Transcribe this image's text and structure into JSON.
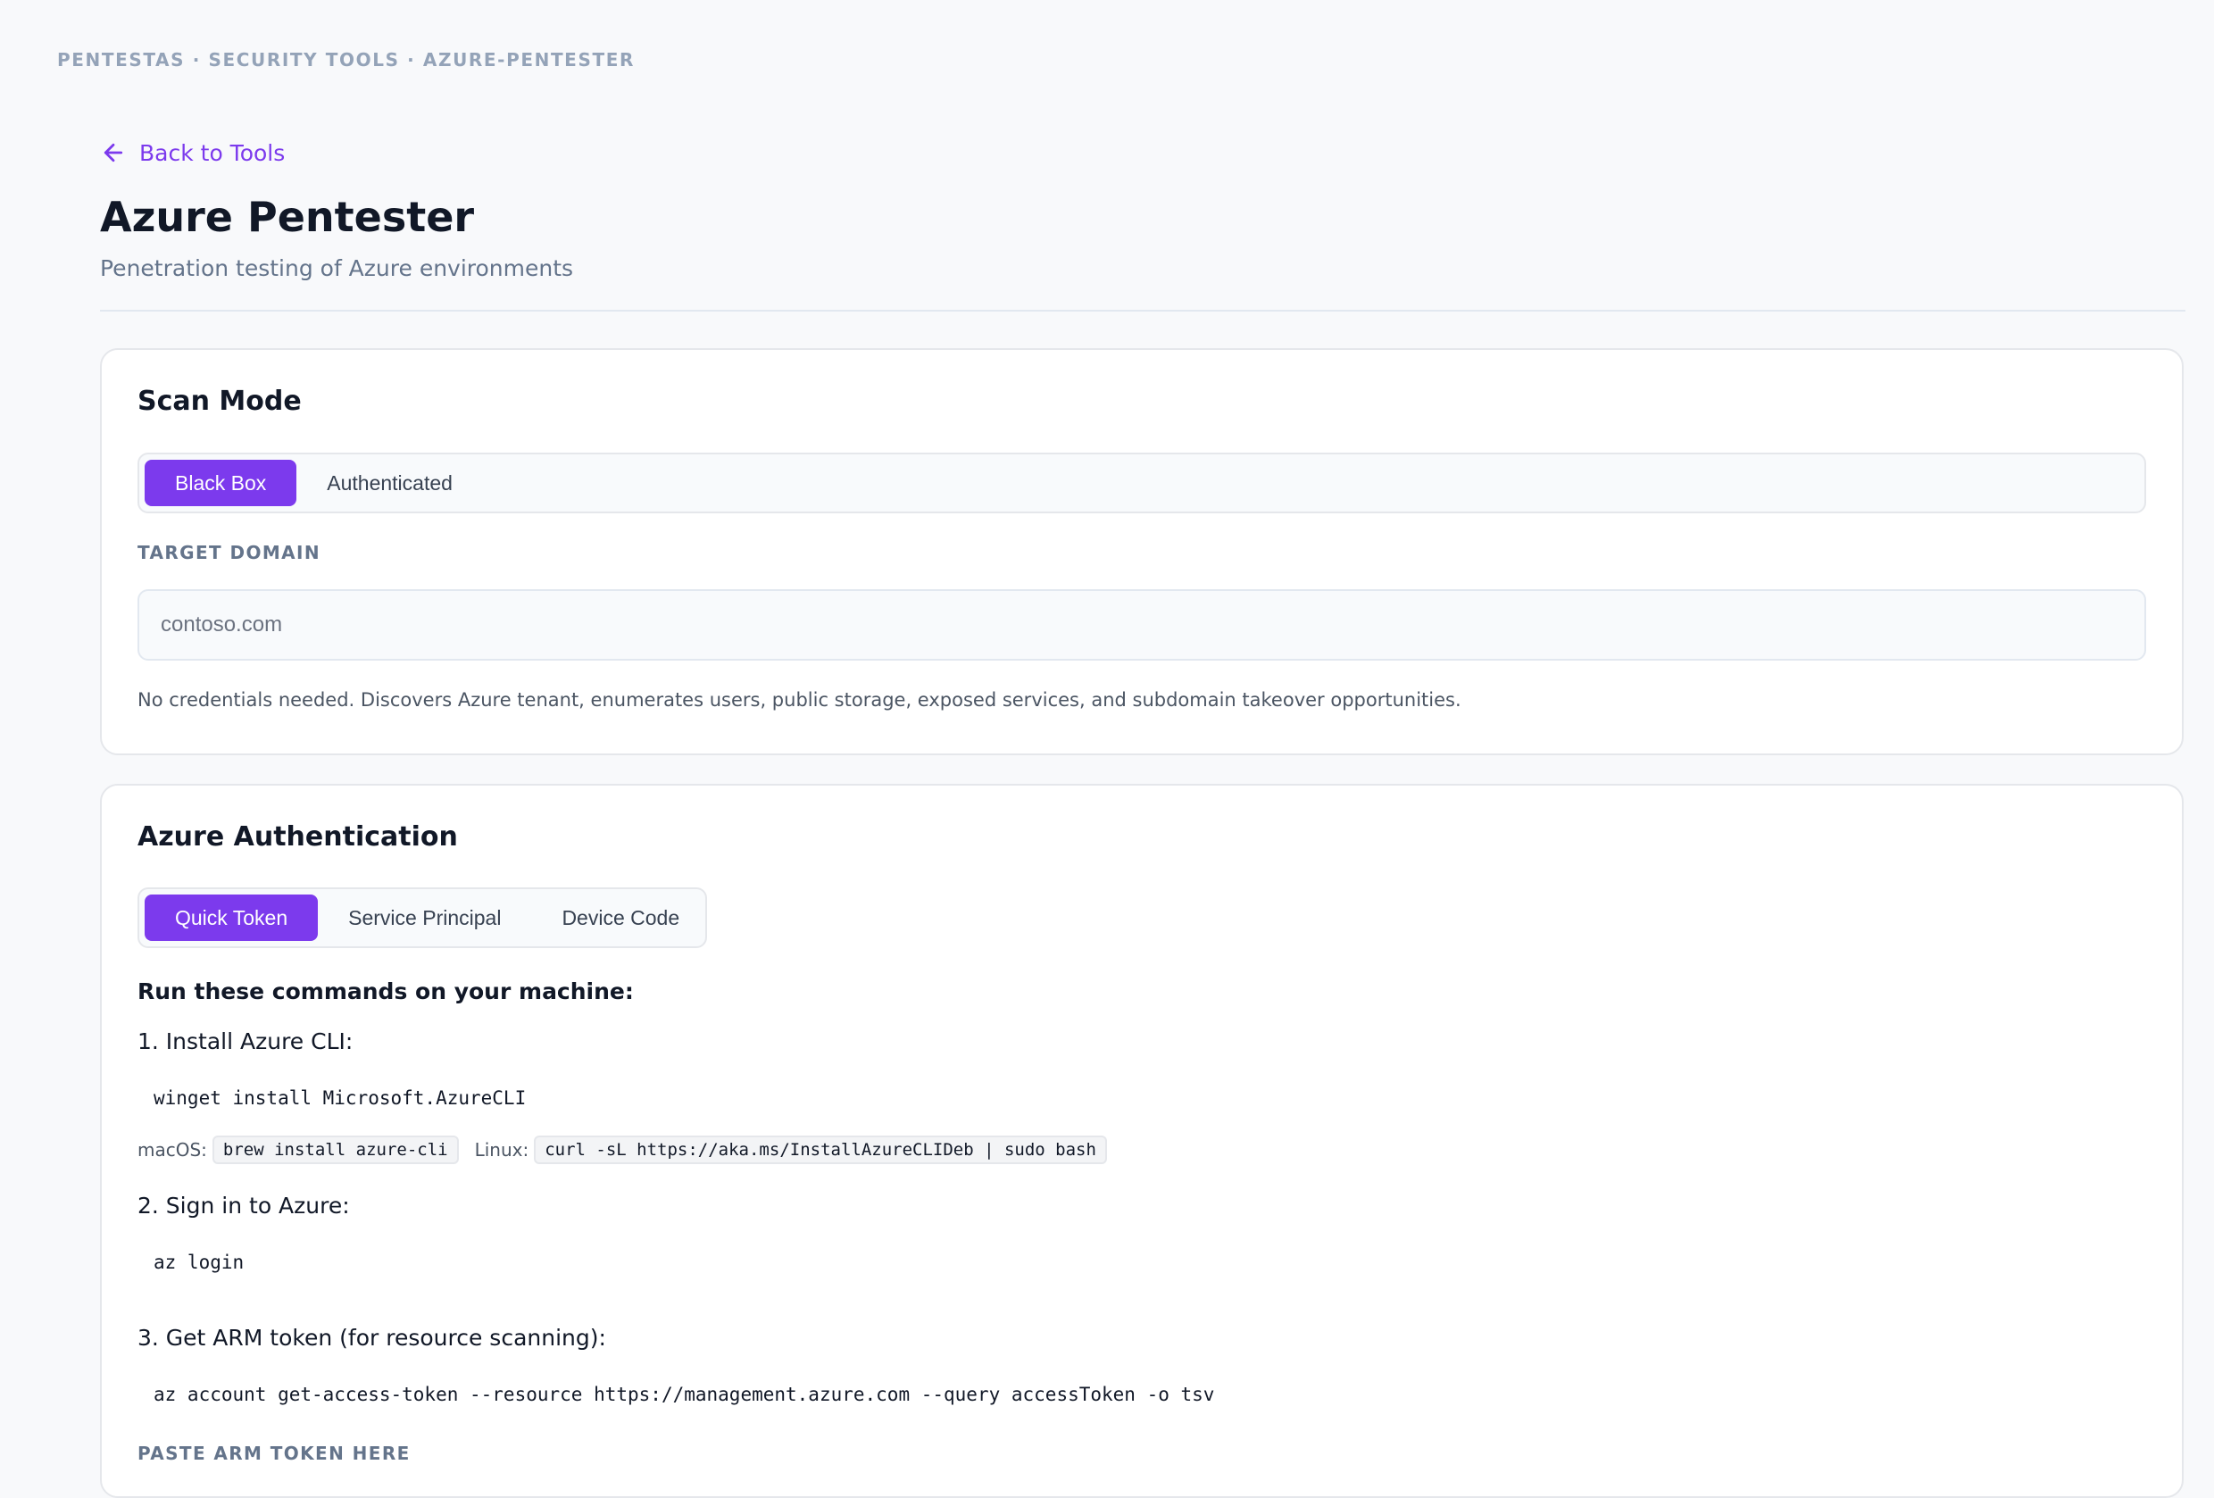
{
  "breadcrumb": "PENTESTAS · SECURITY TOOLS · AZURE-PENTESTER",
  "back_link": {
    "label": "Back to Tools",
    "icon": "arrow-left-icon"
  },
  "header": {
    "title": "Azure Pentester",
    "subtitle": "Penetration testing of Azure environments"
  },
  "accent_color": "#7c3aed",
  "scan_mode": {
    "title": "Scan Mode",
    "options": [
      {
        "label": "Black Box",
        "active": true
      },
      {
        "label": "Authenticated",
        "active": false
      }
    ],
    "target_label": "TARGET DOMAIN",
    "target_placeholder": "contoso.com",
    "target_value": "",
    "hint": "No credentials needed. Discovers Azure tenant, enumerates users, public storage, exposed services, and subdomain takeover opportunities."
  },
  "auth": {
    "title": "Azure Authentication",
    "tabs": [
      {
        "label": "Quick Token",
        "active": true
      },
      {
        "label": "Service Principal",
        "active": false
      },
      {
        "label": "Device Code",
        "active": false
      }
    ],
    "instructions_heading": "Run these commands on your machine:",
    "step1": {
      "label": "1. Install Azure CLI:",
      "command": "winget install Microsoft.AzureCLI",
      "macos_label": "macOS:",
      "macos_command": "brew install azure-cli",
      "linux_label": "Linux:",
      "linux_command": "curl -sL https://aka.ms/InstallAzureCLIDeb | sudo bash"
    },
    "step2": {
      "label": "2. Sign in to Azure:",
      "command": "az login"
    },
    "step3": {
      "label": "3. Get ARM token (for resource scanning):",
      "command": "az account get-access-token --resource https://management.azure.com --query accessToken -o tsv"
    },
    "paste_label": "PASTE ARM TOKEN HERE"
  }
}
